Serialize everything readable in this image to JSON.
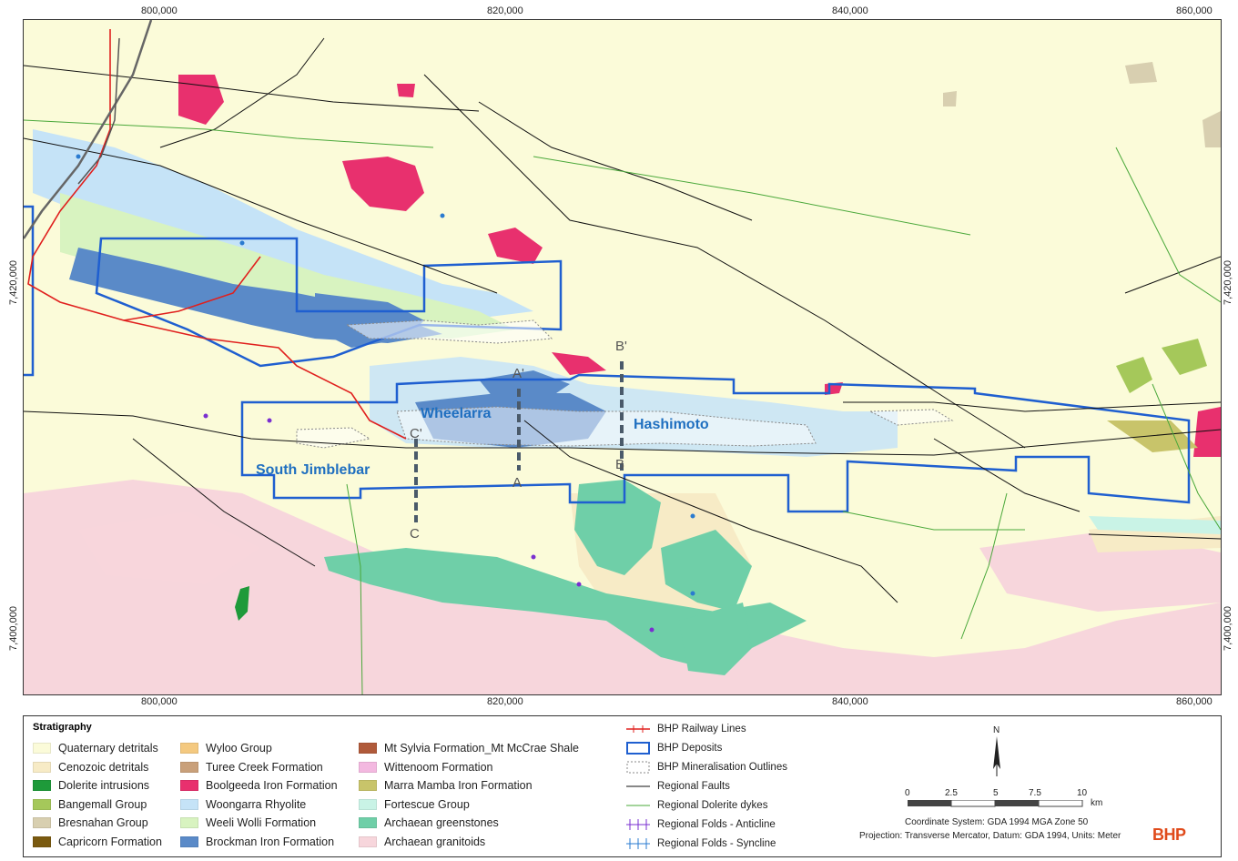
{
  "axes": {
    "x_ticks": [
      "800,000",
      "820,000",
      "840,000",
      "860,000"
    ],
    "y_ticks": [
      "7,420,000",
      "7,400,000"
    ]
  },
  "places": {
    "wheelarra": "Wheelarra",
    "hashimoto": "Hashimoto",
    "south_jimblebar": "South Jimblebar"
  },
  "sections": {
    "a_top": "A'",
    "a_bot": "A",
    "b_top": "B'",
    "b_bot": "B",
    "c_top": "C'",
    "c_bot": "C"
  },
  "legend": {
    "title": "Stratigraphy",
    "units": [
      {
        "label": "Quaternary detritals",
        "color": "#fbfbd9"
      },
      {
        "label": "Cenozoic detritals",
        "color": "#f7ebc6"
      },
      {
        "label": "Dolerite intrusions",
        "color": "#1e9a3a"
      },
      {
        "label": "Bangemall Group",
        "color": "#a5c85a"
      },
      {
        "label": "Bresnahan Group",
        "color": "#d8cfb0"
      },
      {
        "label": "Capricorn Formation",
        "color": "#7a5a10"
      },
      {
        "label": "Wyloo Group",
        "color": "#f4c980"
      },
      {
        "label": "Turee Creek Formation",
        "color": "#c9a07a"
      },
      {
        "label": "Boolgeeda Iron Formation",
        "color": "#e8306e"
      },
      {
        "label": "Woongarra Rhyolite",
        "color": "#c5e3f7"
      },
      {
        "label": "Weeli Wolli Formation",
        "color": "#d8f3c0"
      },
      {
        "label": "Brockman Iron Formation",
        "color": "#5a8ac8"
      },
      {
        "label": "Mt Sylvia Formation_Mt McCrae Shale",
        "color": "#b05a3a"
      },
      {
        "label": "Wittenoom Formation",
        "color": "#f3b8e0"
      },
      {
        "label": "Marra Mamba Iron Formation",
        "color": "#c8c46a"
      },
      {
        "label": "Fortescue Group",
        "color": "#c9f3e6"
      },
      {
        "label": "Archaean greenstones",
        "color": "#6fcfa8"
      },
      {
        "label": "Archaean granitoids",
        "color": "#f7d6dc"
      }
    ],
    "symbols": [
      {
        "label": "BHP Railway Lines",
        "kind": "railway"
      },
      {
        "label": "BHP Deposits",
        "kind": "deposit"
      },
      {
        "label": "BHP Mineralisation Outlines",
        "kind": "mineral"
      },
      {
        "label": "Regional Faults",
        "kind": "fault"
      },
      {
        "label": "Regional Dolerite dykes",
        "kind": "dyke"
      },
      {
        "label": "Regional Folds - Anticline",
        "kind": "anticline"
      },
      {
        "label": "Regional Folds - Syncline",
        "kind": "syncline"
      }
    ]
  },
  "north": "N",
  "scale": {
    "labels": [
      "0",
      "2.5",
      "5",
      "7.5",
      "10"
    ],
    "unit": "km"
  },
  "coords": "Coordinate System: GDA 1994 MGA Zone 50",
  "projection": "Projection: Transverse Mercator,  Datum: GDA 1994,  Units: Meter",
  "logo": "BHP"
}
